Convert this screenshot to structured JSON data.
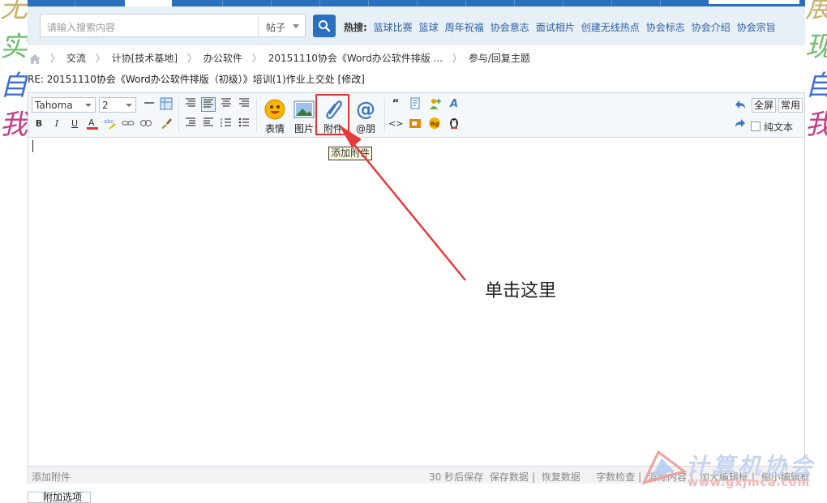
{
  "decoration": {
    "left_chars": [
      "无",
      "实",
      "自",
      "我"
    ],
    "right_chars": [
      "展",
      "现",
      "自",
      "我"
    ]
  },
  "search": {
    "placeholder": "请输入搜索内容",
    "category": "帖子",
    "hot_label": "热搜:",
    "hot_links": [
      "篮球比赛",
      "篮球",
      "周年祝福",
      "协会意志",
      "面试相片",
      "创建无线热点",
      "协会标志",
      "协会介绍",
      "协会宗旨"
    ]
  },
  "breadcrumb": [
    "交流",
    "计协[技术基地]",
    "办公软件",
    "20151110协会《Word办公软件排版 ...",
    "参与/回复主题"
  ],
  "post_title": "RE: 20151110协会《Word办公软件排版（初级）》培训(1)作业上交处 [修改]",
  "toolbar": {
    "font": "Tahoma",
    "size": "2",
    "emoji_label": "表情",
    "image_label": "图片",
    "attach_label": "附件",
    "at_label": "@朋",
    "fullscreen": "全屏",
    "common": "常用",
    "plain_text": "纯文本",
    "attach_tooltip": "添加附件"
  },
  "status": {
    "left": "添加附件",
    "autosave": "30 秒后保存",
    "save": "保存数据",
    "restore": "恢复数据",
    "check": "字数检查",
    "clear": "清除内容",
    "enlarge": "加大编辑框",
    "shrink": "缩小编辑框"
  },
  "annotation": "单击这里",
  "watermark": {
    "name": "计算机协会",
    "url": "www.gxjmca.com"
  },
  "attach_options": "附加选项",
  "colors": {
    "nav": "#2b6fbf",
    "highlight": "#e53333",
    "link": "#2b5fa3"
  }
}
